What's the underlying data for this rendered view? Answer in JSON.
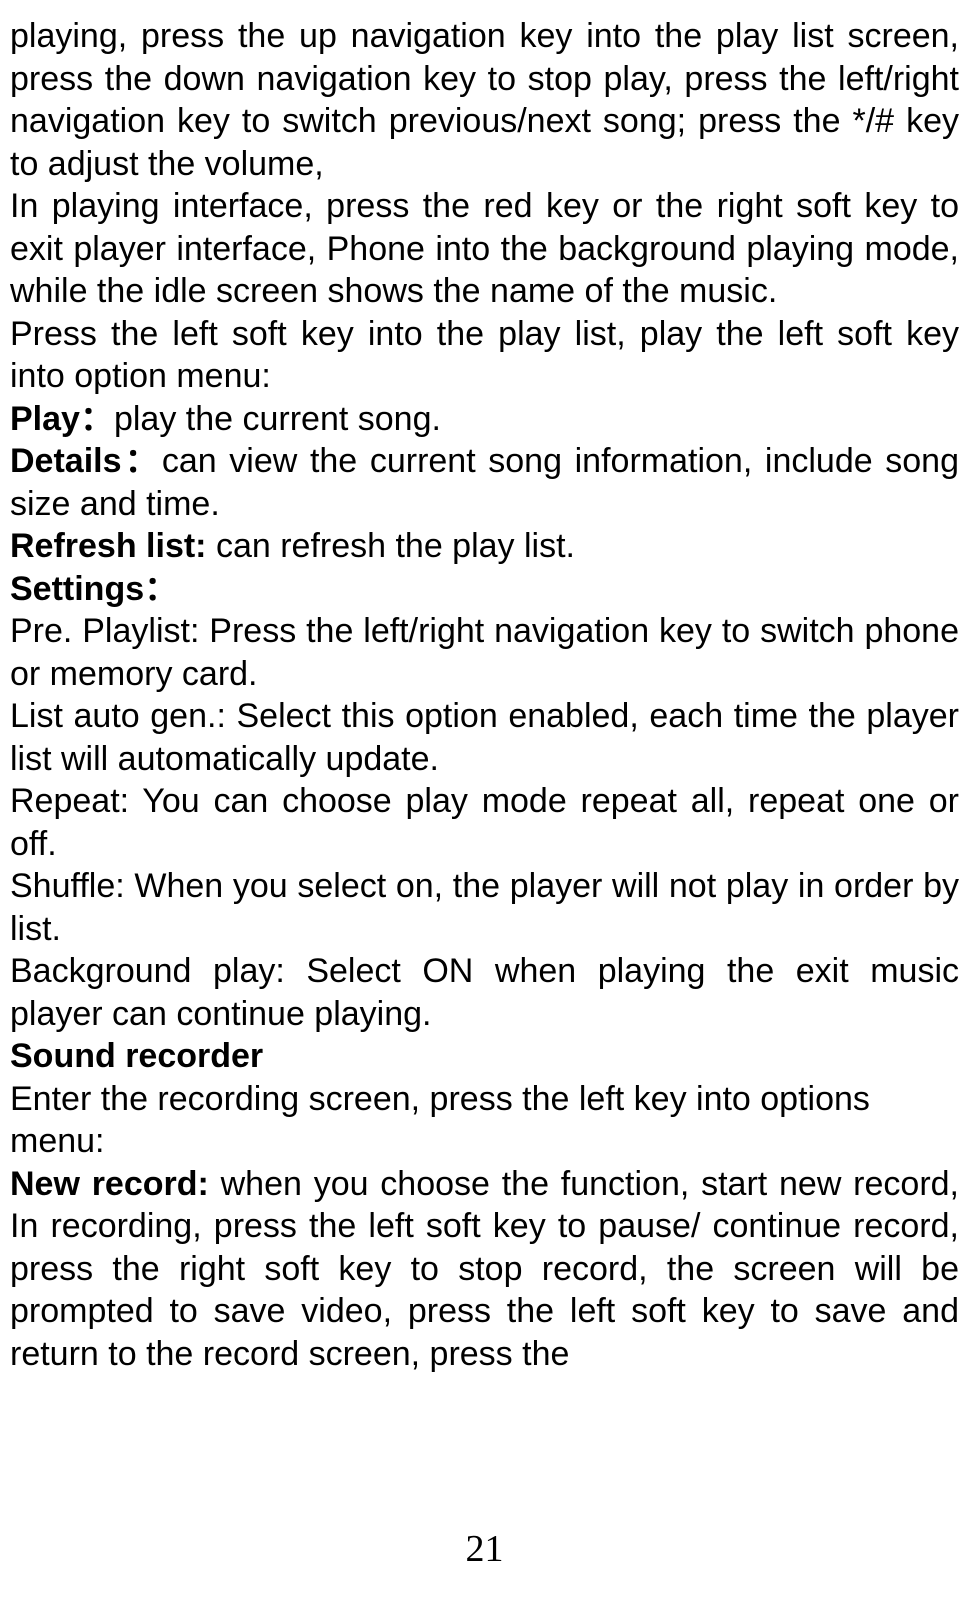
{
  "p1": "playing, press the up navigation key into the play list screen, press the down navigation key to stop play, press the left/right navigation key to switch previous/next song; press the */# key to adjust the volume,",
  "p2": "In playing interface, press the red key or the right soft key to exit player interface, Phone into the background playing mode, while the idle screen shows the name of the music.",
  "p3": "Press the left soft key into the play list, play the left soft key into option menu:",
  "play_label": "Play：",
  "play_text": "play the current song.",
  "details_label": "Details：",
  "details_text": "can view the current song information, include song size and time.",
  "refresh_label": "Refresh list:",
  "refresh_text": " can refresh the play list.",
  "settings_label": "Settings：",
  "s1": "Pre. Playlist: Press the left/right navigation key to switch phone or memory card.",
  "s2": "List auto gen.: Select this option enabled, each time the player list will automatically update.",
  "s3": "Repeat: You can choose play mode repeat all, repeat one or off.",
  "s4": "Shuffle: When you select on, the player will not play in order by list.",
  "s5": "Background play:  Select ON when playing the exit music player can continue playing.",
  "sound_recorder_label": "Sound recorder",
  "sr_text": "Enter the recording screen, press the left key into options menu:",
  "new_record_label": "New record:",
  "new_record_text": " when you choose the function, start new record, In recording, press the left soft key to pause/ continue record, press the right soft key to stop record, the screen will be prompted to save video, press the left soft key to save and return to the record screen, press the",
  "page_number": "21"
}
